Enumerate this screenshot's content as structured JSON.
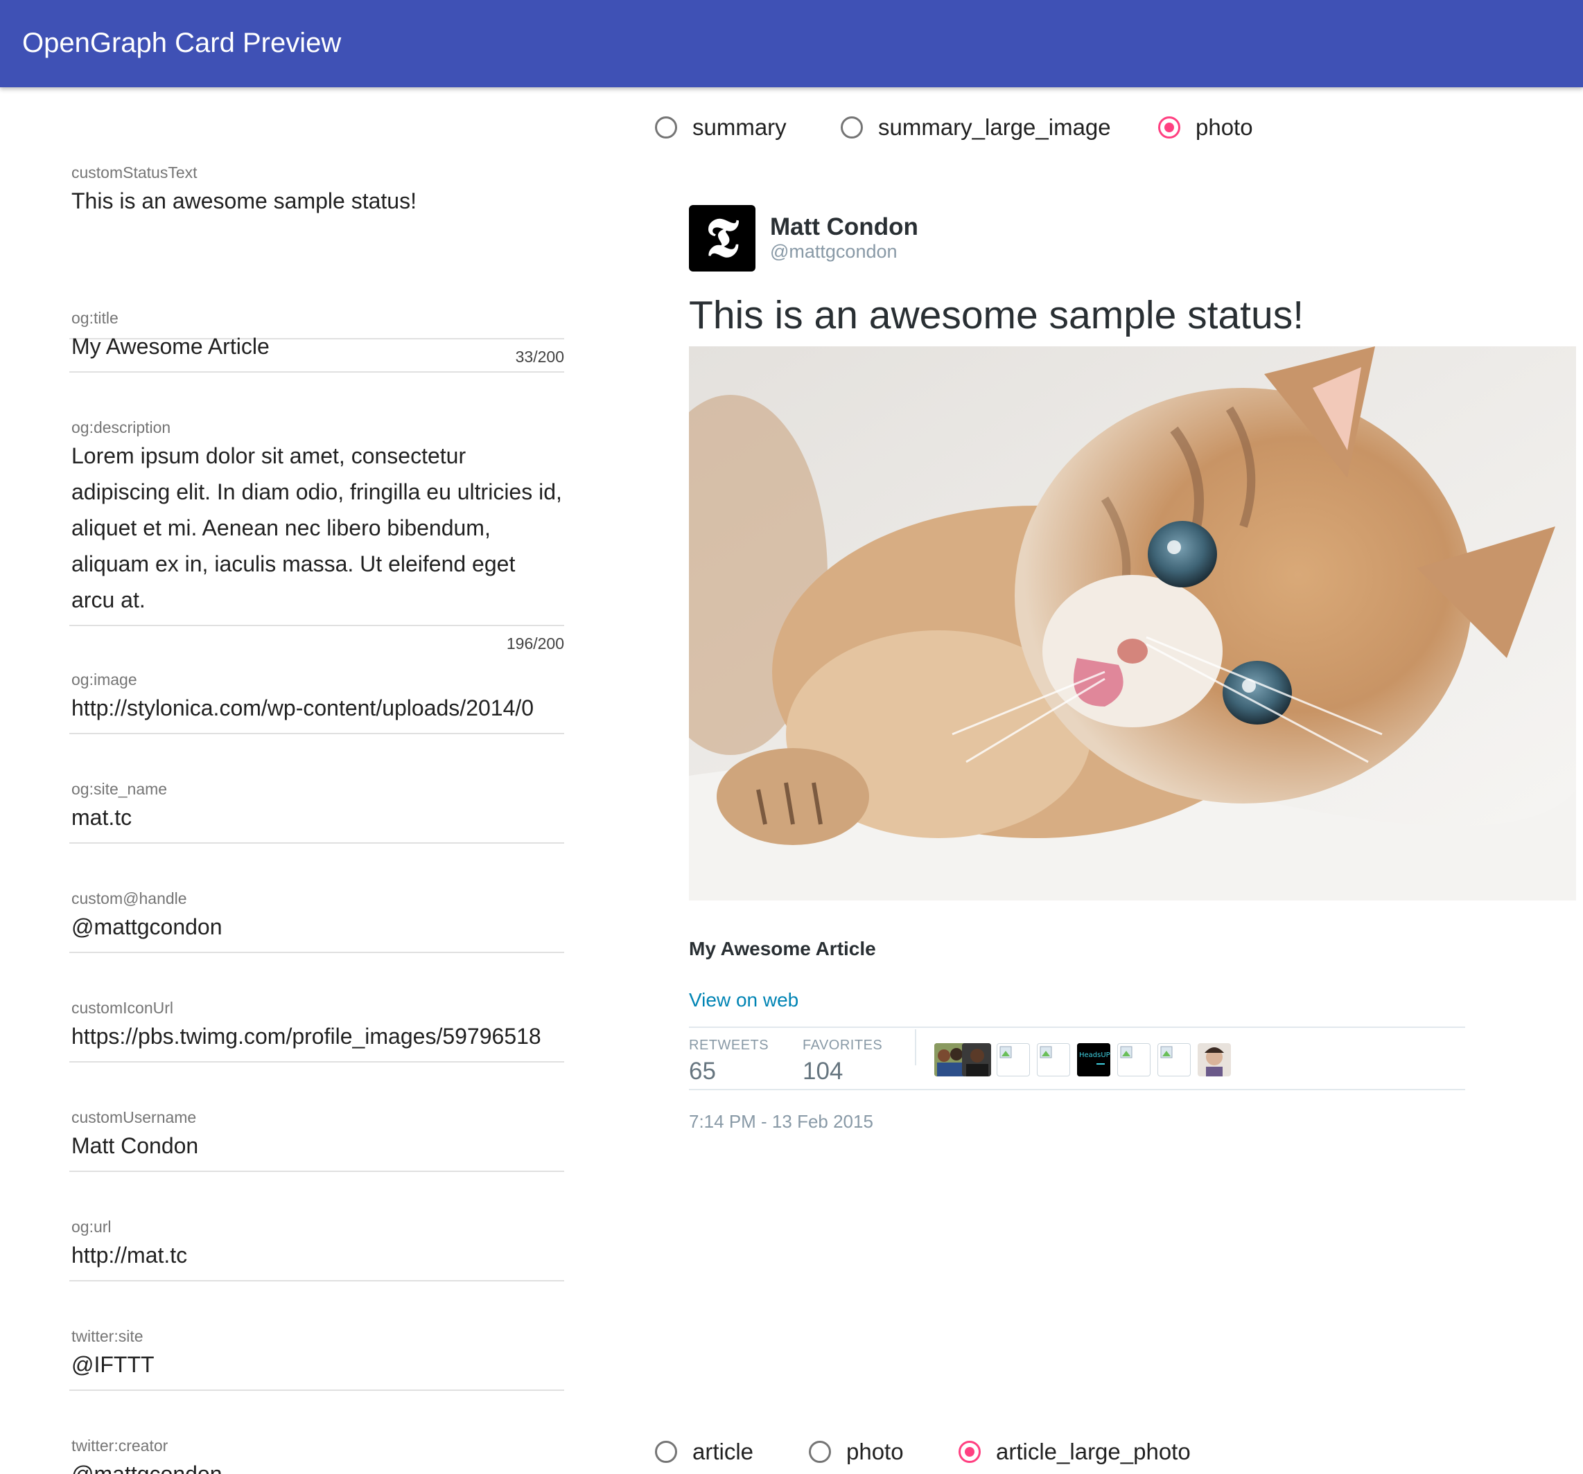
{
  "appbar": {
    "title": "OpenGraph Card Preview"
  },
  "form": {
    "fields": [
      {
        "label": "customStatusText",
        "value": "This is an awesome sample status!",
        "counter": "33/200"
      },
      {
        "label": "og:title",
        "value": "My Awesome Article"
      },
      {
        "label": "og:description",
        "value": "Lorem ipsum dolor sit amet, consectetur adipiscing elit. In diam odio, fringilla eu ultricies id, aliquet et mi. Aenean nec libero bibendum, aliquam ex in, iaculis massa. Ut eleifend eget arcu at.",
        "counter": "196/200"
      },
      {
        "label": "og:image",
        "value": "http://stylonica.com/wp-content/uploads/2014/0"
      },
      {
        "label": "og:site_name",
        "value": "mat.tc"
      },
      {
        "label": "custom@handle",
        "value": "@mattgcondon"
      },
      {
        "label": "customIconUrl",
        "value": "https://pbs.twimg.com/profile_images/59796518"
      },
      {
        "label": "customUsername",
        "value": "Matt Condon"
      },
      {
        "label": "og:url",
        "value": "http://mat.tc"
      },
      {
        "label": "twitter:site",
        "value": "@IFTTT"
      },
      {
        "label": "twitter:creator",
        "value": "@mattgcondon"
      }
    ]
  },
  "card_type_radios": {
    "options": [
      "summary",
      "summary_large_image",
      "photo"
    ],
    "selected": "photo"
  },
  "layout_radios": {
    "options": [
      "article",
      "photo",
      "article_large_photo"
    ],
    "selected": "article_large_photo"
  },
  "tweet": {
    "avatar_glyph": "𝕿",
    "name": "Matt Condon",
    "handle": "@mattgcondon",
    "status": "This is an awesome sample status!",
    "photo_icon": "kitten-photo",
    "card_title": "My Awesome Article",
    "view_link": "View on web",
    "retweets_label": "RETWEETS",
    "retweets_value": "65",
    "favorites_label": "FAVORITES",
    "favorites_value": "104",
    "faces_text": "HeadsUP!",
    "timestamp": "7:14 PM - 13 Feb 2015"
  },
  "colors": {
    "appbar": "#3f51b5",
    "accent": "#ff4081",
    "link": "#0084b4"
  }
}
